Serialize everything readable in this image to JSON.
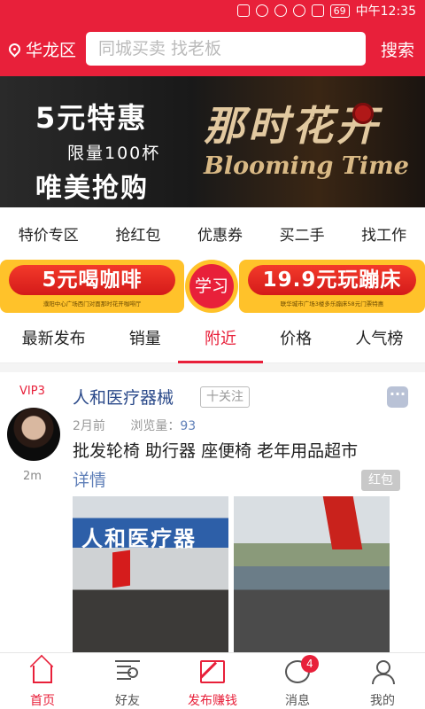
{
  "status_bar": {
    "battery": "69",
    "time": "中午12:35"
  },
  "header": {
    "location": "华龙区",
    "search_placeholder": "同城买卖 找老板",
    "search_button": "搜索"
  },
  "banner": {
    "line1": "5元特惠",
    "line2": "限量100杯",
    "line3": "唯美抢购",
    "brand_cn": "那时花开",
    "brand_en": "Blooming Time"
  },
  "quick_nav": [
    "特价专区",
    "抢红包",
    "优惠券",
    "买二手",
    "找工作"
  ],
  "promos": {
    "left": {
      "title": "5元喝咖啡",
      "sub": "濮阳中心广场西门对面那时花开咖啡厅"
    },
    "center": "学习",
    "right": {
      "title": "19.9元玩蹦床",
      "sub": "联华城市广场3楼多乐蹦床58元门票特惠"
    }
  },
  "tabs": [
    "最新发布",
    "销量",
    "附近",
    "价格",
    "人气榜"
  ],
  "active_tab": "附近",
  "post": {
    "vip": "VIP3",
    "distance": "2m",
    "username": "人和医疗器械",
    "follow": "十关注",
    "time": "2月前",
    "views_label": "浏览量：",
    "views": "93",
    "title": "批发轮椅 助行器 座便椅 老年用品超市",
    "detail": "详情",
    "red_packet": "红包",
    "photo1_sign": "人和医疗器"
  },
  "bottom_nav": [
    {
      "label": "首页",
      "icon": "home-icon",
      "active": true
    },
    {
      "label": "好友",
      "icon": "friends-icon"
    },
    {
      "label": "发布赚钱",
      "icon": "edit-icon",
      "active": true
    },
    {
      "label": "消息",
      "icon": "message-icon",
      "badge": "4"
    },
    {
      "label": "我的",
      "icon": "profile-icon"
    }
  ],
  "colors": {
    "brand_red": "#e8203a",
    "promo_yellow": "#ffc22a",
    "link_blue": "#5f7fb8"
  }
}
